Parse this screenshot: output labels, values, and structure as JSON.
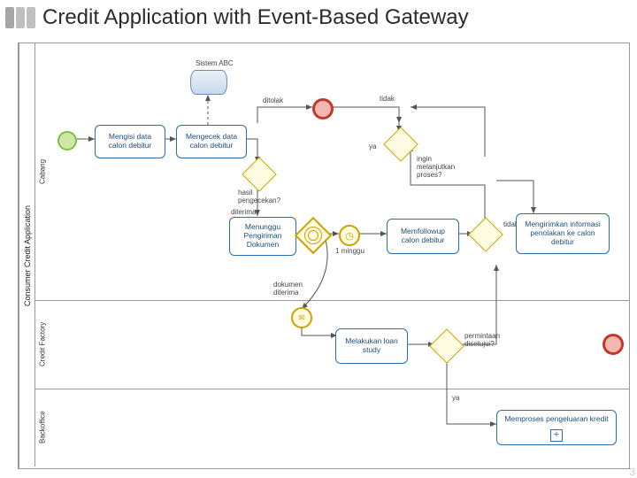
{
  "title": "Credit Application with Event-Based Gateway",
  "pool": "Consumer Credit Application",
  "lanes": {
    "cabang": "Cabang",
    "credit_factory": "Credit Factory",
    "backoffice": "Backoffice"
  },
  "nodes": {
    "sistem_abc": "Sistem ABC",
    "mengisi": "Mengisi data\ncalon debitur",
    "mengecek": "Mengecek data\ncalon debitur",
    "menunggu": "Menunggu\nPengiriman\nDokumen",
    "memfollowup": "Memfollowup\ncalon debitur",
    "mengirimkan": "Mengirimkan\ninformasi penolakan\nke calon debitur",
    "loan_study": "Melakukan\nloan study",
    "memproses": "Memproses pengeluaran kredit"
  },
  "labels": {
    "hasil": "hasil\npengecekan?",
    "ditolak": "ditolak",
    "diterima": "diterima",
    "ya": "ya",
    "tidak": "tidak",
    "ingin_melanjutkan": "ingin\nmelanjutkan\nproses?",
    "satu_minggu": "1 minggu",
    "dokumen_diterima": "dokumen\nditerima",
    "permintaan_disetujui": "permintaan\ndisetujui?"
  },
  "chart_data": {
    "type": "table",
    "notation": "BPMN",
    "title": "Credit Application with Event-Based Gateway",
    "pool": "Consumer Credit Application",
    "lanes": [
      "Cabang",
      "Credit Factory",
      "Backoffice"
    ],
    "elements": [
      {
        "id": "start",
        "type": "startEvent",
        "lane": "Cabang"
      },
      {
        "id": "sistem_abc",
        "type": "dataStore",
        "label": "Sistem ABC",
        "lane": "Cabang"
      },
      {
        "id": "mengisi",
        "type": "task",
        "label": "Mengisi data calon debitur",
        "lane": "Cabang"
      },
      {
        "id": "mengecek",
        "type": "task",
        "label": "Mengecek data calon debitur",
        "lane": "Cabang"
      },
      {
        "id": "g_hasil",
        "type": "exclusiveGateway",
        "label": "hasil pengecekan?",
        "lane": "Cabang"
      },
      {
        "id": "end_reject",
        "type": "endEvent",
        "lane": "Cabang"
      },
      {
        "id": "g_lanjut",
        "type": "exclusiveGateway",
        "label": "ingin melanjutkan proses?",
        "lane": "Cabang"
      },
      {
        "id": "menunggu",
        "type": "task",
        "label": "Menunggu Pengiriman Dokumen",
        "lane": "Cabang"
      },
      {
        "id": "g_event",
        "type": "eventBasedGateway",
        "lane": "Cabang"
      },
      {
        "id": "ev_timer",
        "type": "intermediateCatchEvent",
        "subtype": "timer",
        "label": "1 minggu",
        "lane": "Cabang"
      },
      {
        "id": "ev_msg",
        "type": "intermediateCatchEvent",
        "subtype": "message",
        "label": "dokumen diterima",
        "lane": "Cabang"
      },
      {
        "id": "memfollowup",
        "type": "task",
        "label": "Memfollowup calon debitur",
        "lane": "Cabang"
      },
      {
        "id": "mengirimkan",
        "type": "task",
        "label": "Mengirimkan informasi penolakan ke calon debitur",
        "lane": "Cabang"
      },
      {
        "id": "loan_study",
        "type": "task",
        "label": "Melakukan loan study",
        "lane": "Credit Factory"
      },
      {
        "id": "g_setuju",
        "type": "exclusiveGateway",
        "label": "permintaan disetujui?",
        "lane": "Credit Factory"
      },
      {
        "id": "memproses",
        "type": "subProcess",
        "label": "Memproses pengeluaran kredit",
        "lane": "Backoffice"
      }
    ],
    "flows": [
      {
        "from": "start",
        "to": "mengisi"
      },
      {
        "from": "mengisi",
        "to": "mengecek"
      },
      {
        "from": "mengecek",
        "to": "sistem_abc",
        "type": "dataAssociation"
      },
      {
        "from": "mengecek",
        "to": "g_hasil"
      },
      {
        "from": "g_hasil",
        "to": "end_reject",
        "label": "ditolak"
      },
      {
        "from": "g_hasil",
        "to": "menunggu",
        "label": "diterima"
      },
      {
        "from": "menunggu",
        "to": "g_event"
      },
      {
        "from": "g_event",
        "to": "ev_timer"
      },
      {
        "from": "g_event",
        "to": "ev_msg"
      },
      {
        "from": "ev_timer",
        "to": "memfollowup"
      },
      {
        "from": "memfollowup",
        "to": "g_lanjut"
      },
      {
        "from": "g_lanjut",
        "to": "menunggu",
        "label": "ya"
      },
      {
        "from": "g_lanjut",
        "to": "end_reject",
        "label": "tidak"
      },
      {
        "from": "ev_msg",
        "to": "loan_study"
      },
      {
        "from": "loan_study",
        "to": "g_setuju"
      },
      {
        "from": "g_setuju",
        "to": "mengirimkan",
        "label": "tidak"
      },
      {
        "from": "g_setuju",
        "to": "memproses",
        "label": "ya"
      }
    ]
  }
}
